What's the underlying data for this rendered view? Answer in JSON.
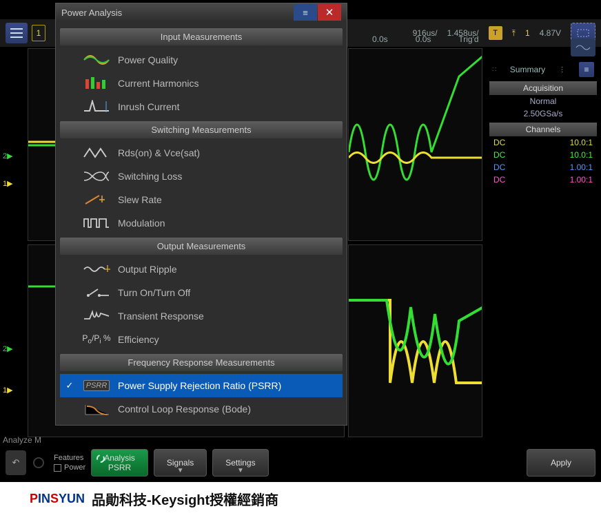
{
  "topbar": {
    "time_per_div1": "916us/",
    "time_per_div2": "1.458us/",
    "delay1": "0.0s",
    "delay2": "0.0s",
    "trig_status": "Trig'd",
    "trig_ch": "1",
    "trig_level": "4.87V",
    "trig_badge": "T"
  },
  "summary": {
    "title": "Summary",
    "acquisition_hdr": "Acquisition",
    "acq_mode": "Normal",
    "sample_rate": "2.50GSa/s",
    "channels_hdr": "Channels",
    "channels": [
      {
        "name": "DC",
        "ratio": "10.0:1",
        "cls": "ch-yellow"
      },
      {
        "name": "DC",
        "ratio": "10.0:1",
        "cls": "ch-green"
      },
      {
        "name": "DC",
        "ratio": "1.00:1",
        "cls": "ch-blue"
      },
      {
        "name": "DC",
        "ratio": "1.00:1",
        "cls": "ch-pink"
      }
    ]
  },
  "bottom": {
    "features_label": "Features",
    "power_label": "Power",
    "analysis_label": "Analysis",
    "analysis_sub": "PSRR",
    "signals_label": "Signals",
    "settings_label": "Settings",
    "apply_label": "Apply",
    "analyze_mode": "Analyze M"
  },
  "dialog": {
    "title": "Power Analysis",
    "sections": {
      "input": "Input Measurements",
      "switching": "Switching Measurements",
      "output": "Output Measurements",
      "freq": "Frequency Response Measurements"
    },
    "items": {
      "power_quality": "Power Quality",
      "current_harmonics": "Current Harmonics",
      "inrush_current": "Inrush Current",
      "rds_vce": "Rds(on) & Vce(sat)",
      "switching_loss": "Switching Loss",
      "slew_rate": "Slew Rate",
      "modulation": "Modulation",
      "output_ripple": "Output Ripple",
      "turn_on_off": "Turn On/Turn Off",
      "transient_response": "Transient Response",
      "efficiency": "Efficiency",
      "psrr": "Power Supply Rejection Ratio (PSRR)",
      "psrr_badge": "PSRR",
      "bode": "Control Loop Response (Bode)"
    }
  },
  "footer": {
    "brand_p": "P",
    "brand_in": "IN",
    "brand_s": "S",
    "brand_yun": "YUN",
    "tagline": "品勛科技-Keysight授權經銷商"
  },
  "ch_badge": "1"
}
